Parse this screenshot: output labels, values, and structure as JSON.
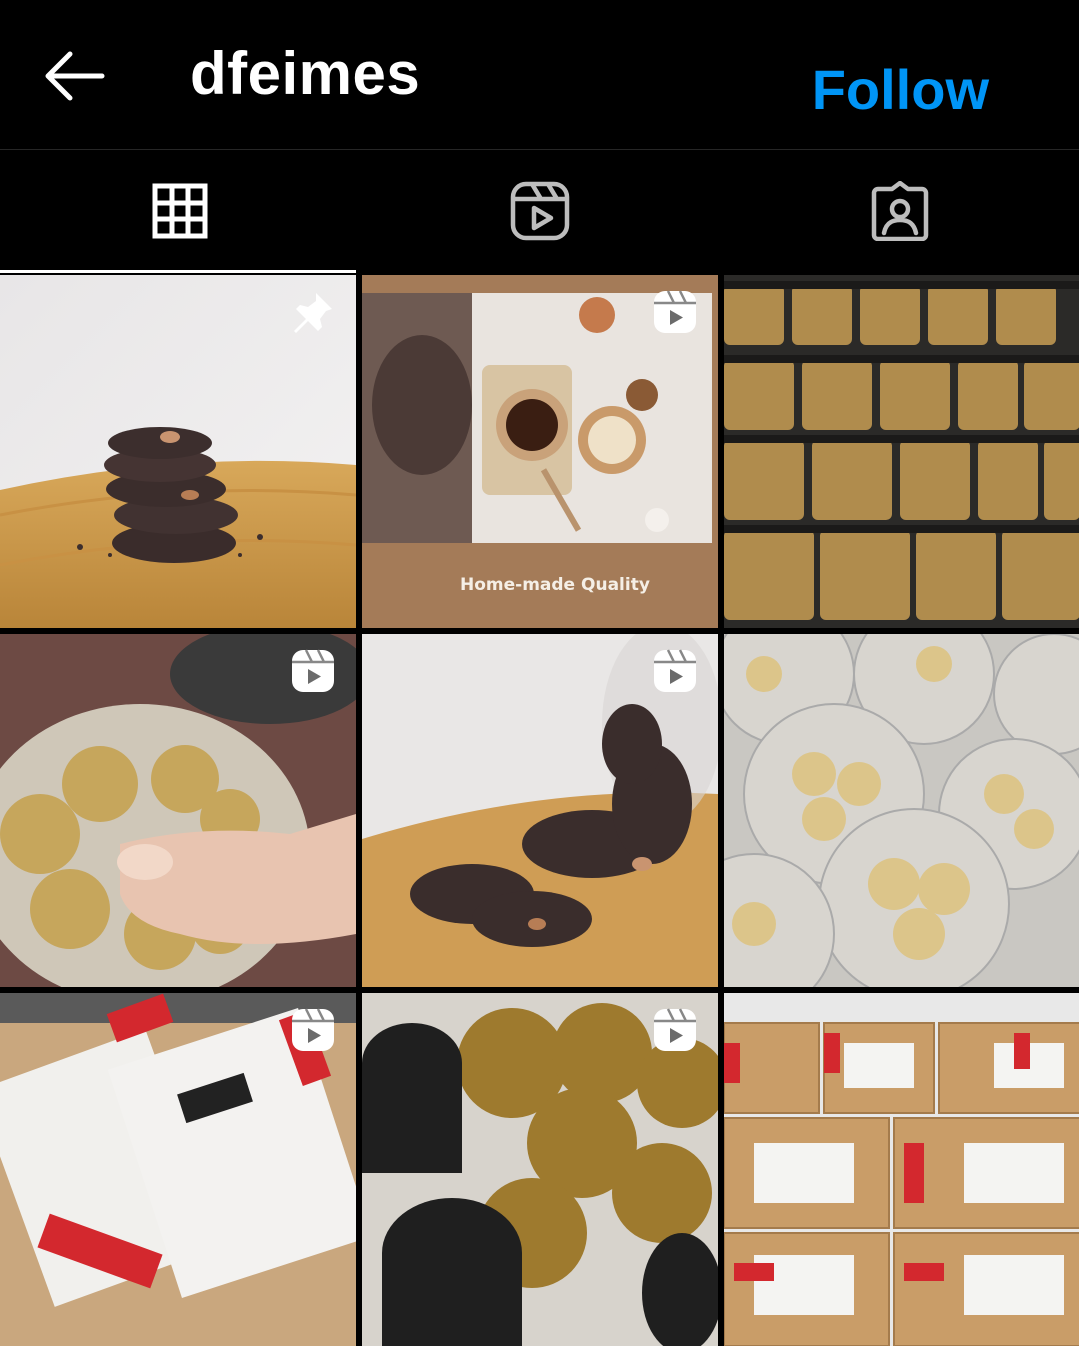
{
  "header": {
    "username": "dfeimes",
    "follow_label": "Follow",
    "back_icon": "arrow-left-icon",
    "accent_color": "#0095f6"
  },
  "tabs": [
    {
      "icon": "grid-icon",
      "active": true
    },
    {
      "icon": "reels-icon",
      "active": false
    },
    {
      "icon": "tagged-icon",
      "active": false
    }
  ],
  "posts": [
    {
      "subject": "stacked chocolate cookies on wooden board",
      "badge": "pin-icon",
      "caption": ""
    },
    {
      "subject": "baking table with bowls and whisk",
      "badge": "reels-icon",
      "caption": "Home-made Quality"
    },
    {
      "subject": "shelves of cookie jars",
      "badge": "",
      "caption": ""
    },
    {
      "subject": "hand picking cookie from jar",
      "badge": "reels-icon",
      "caption": ""
    },
    {
      "subject": "chocolate cookies spilling from jar",
      "badge": "reels-icon",
      "caption": ""
    },
    {
      "subject": "jars of round sugar cookies",
      "badge": "",
      "caption": ""
    },
    {
      "subject": "fragile parcels ready to ship",
      "badge": "reels-icon",
      "caption": ""
    },
    {
      "subject": "open jars of cookies",
      "badge": "reels-icon",
      "caption": ""
    },
    {
      "subject": "stack of labelled boxes",
      "badge": "",
      "caption": ""
    }
  ]
}
